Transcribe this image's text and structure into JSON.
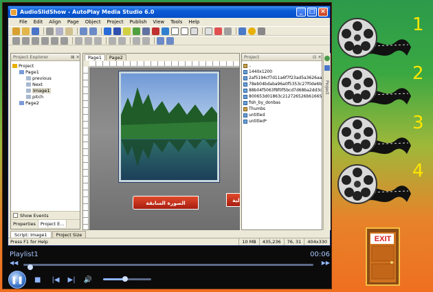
{
  "window": {
    "title": "AudioSlidShow - AutoPlay Media Studio 6.0"
  },
  "menu": [
    "File",
    "Edit",
    "Align",
    "Page",
    "Object",
    "Project",
    "Publish",
    "View",
    "Tools",
    "Help"
  ],
  "explorer": {
    "title": "Project Explorer",
    "tree": [
      {
        "label": "Project",
        "indent": 0
      },
      {
        "label": "Page1",
        "indent": 1
      },
      {
        "label": "previous",
        "indent": 2
      },
      {
        "label": "Next",
        "indent": 2
      },
      {
        "label": "Image1",
        "indent": 2,
        "selected": true
      },
      {
        "label": "pitch",
        "indent": 2
      },
      {
        "label": "Page2",
        "indent": 1
      }
    ],
    "show_events_label": "Show Events",
    "bottom_tabs": [
      "Properties",
      "Project E..."
    ]
  },
  "doc_tabs": [
    "Page1",
    "Page2"
  ],
  "stage": {
    "button_previous": "الصورة السابقة",
    "button_next": "التالية"
  },
  "project_panel": {
    "title": "Project",
    "files": [
      {
        "name": "..",
        "type": "folder"
      },
      {
        "name": "1440x1200",
        "type": "image"
      },
      {
        "name": "2af5194cf7d11a6f7f23ad5a3626aa2f6",
        "type": "image"
      },
      {
        "name": "78eb04bdaba96a0f5353c27f0de6bf",
        "type": "image"
      },
      {
        "name": "88b04f5063f8f0f5bcd7d68ba2dd3c",
        "type": "image"
      },
      {
        "name": "800653d01863c212726526b61665",
        "type": "image"
      },
      {
        "name": "fish_by_donbas",
        "type": "image"
      },
      {
        "name": "Thumbs",
        "type": "file"
      },
      {
        "name": "untitled",
        "type": "image"
      },
      {
        "name": "untitled*",
        "type": "image"
      }
    ],
    "side_tab": "Project"
  },
  "bottom_tabs": [
    "Script: Image1",
    "Project Size"
  ],
  "status": {
    "help": "Press F1 for Help",
    "size": "10 MB",
    "pos": "435,236",
    "xy": "76, 31",
    "dims": "404x330"
  },
  "player": {
    "playlist": "Playlist1",
    "time": "00:06",
    "seek_fraction": 0.02,
    "volume_fraction": 0.45
  },
  "right_panel": {
    "numbers": [
      "1",
      "2",
      "3",
      "4"
    ],
    "exit_label": "EXIT"
  },
  "colors": {
    "accent_blue": "#0a5ad6",
    "number_yellow": "#ffe600",
    "exit_red": "#d81e1e"
  }
}
